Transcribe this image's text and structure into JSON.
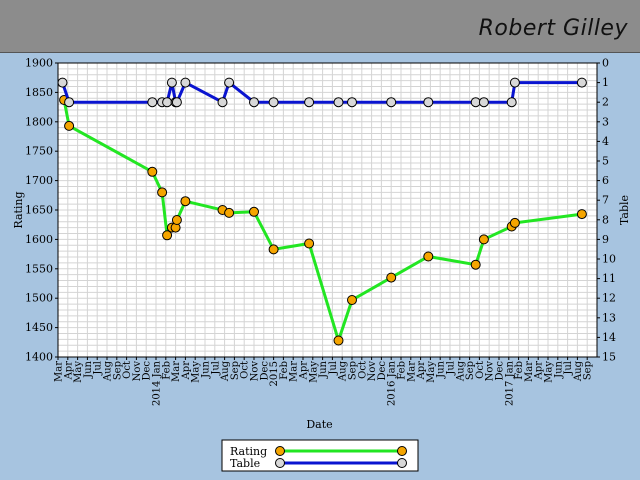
{
  "header": {
    "player_name": "Robert Gilley"
  },
  "colors": {
    "rating_line": "#22e622",
    "table_line": "#0a14d0",
    "rating_marker": "#f5a500",
    "table_marker": "#d8d8d8",
    "plot_bg": "#ffffff",
    "grid": "#d4d4d4",
    "frame_bg": "#a7c4e0",
    "banner_bg": "#8c8c8c"
  },
  "chart_data": {
    "type": "line",
    "xlabel": "Date",
    "ylabel": "Rating",
    "y2label": "Table",
    "ylim": [
      1400,
      1900
    ],
    "y2lim": [
      0,
      15
    ],
    "y2_inverted": true,
    "grid": true,
    "legend_position": "bottom-center",
    "x_tick_labels": [
      "Mar",
      "Apr",
      "May",
      "Jun",
      "Jul",
      "Aug",
      "Sep",
      "Oct",
      "Nov",
      "Dec",
      "2014 Jan",
      "Feb",
      "Mar",
      "Apr",
      "May",
      "Jun",
      "Jul",
      "Aug",
      "Sep",
      "Oct",
      "Nov",
      "Dec",
      "2015",
      "Feb",
      "Mar",
      "Apr",
      "May",
      "Jun",
      "Jul",
      "Aug",
      "Sep",
      "Oct",
      "Nov",
      "Dec",
      "2016 Jan",
      "Feb",
      "Mar",
      "Apr",
      "May",
      "Jun",
      "Jul",
      "Aug",
      "Sep",
      "Oct",
      "Nov",
      "Dec",
      "2017 Jan",
      "Feb",
      "Mar",
      "Apr",
      "May",
      "Jun",
      "Jul",
      "Aug",
      "Sep"
    ],
    "y_ticks": [
      1400,
      1450,
      1500,
      1550,
      1600,
      1650,
      1700,
      1750,
      1800,
      1850,
      1900
    ],
    "y2_ticks": [
      0,
      1,
      2,
      3,
      4,
      5,
      6,
      7,
      8,
      9,
      10,
      11,
      12,
      13,
      14,
      15
    ],
    "series": [
      {
        "name": "Rating",
        "axis": "left",
        "points": [
          [
            "2013-03-20",
            1837
          ],
          [
            "2013-04-05",
            1793
          ],
          [
            "2013-12-20",
            1715
          ],
          [
            "2014-01-20",
            1680
          ],
          [
            "2014-02-05",
            1607
          ],
          [
            "2014-02-20",
            1620
          ],
          [
            "2014-03-01",
            1620
          ],
          [
            "2014-03-05",
            1633
          ],
          [
            "2014-04-01",
            1665
          ],
          [
            "2014-07-25",
            1650
          ],
          [
            "2014-08-15",
            1645
          ],
          [
            "2014-11-01",
            1647
          ],
          [
            "2015-01-01",
            1583
          ],
          [
            "2015-04-20",
            1593
          ],
          [
            "2015-07-20",
            1428
          ],
          [
            "2015-09-01",
            1497
          ],
          [
            "2016-01-01",
            1535
          ],
          [
            "2016-04-25",
            1571
          ],
          [
            "2016-09-20",
            1557
          ],
          [
            "2016-10-15",
            1600
          ],
          [
            "2017-01-10",
            1622
          ],
          [
            "2017-01-20",
            1628
          ],
          [
            "2017-08-15",
            1643
          ]
        ]
      },
      {
        "name": "Table",
        "axis": "right",
        "points": [
          [
            "2013-03-15",
            1
          ],
          [
            "2013-04-05",
            2
          ],
          [
            "2013-12-20",
            2
          ],
          [
            "2014-01-20",
            2
          ],
          [
            "2014-02-05",
            2
          ],
          [
            "2014-02-20",
            1
          ],
          [
            "2014-03-01",
            2
          ],
          [
            "2014-03-05",
            2
          ],
          [
            "2014-04-01",
            1
          ],
          [
            "2014-07-25",
            2
          ],
          [
            "2014-08-15",
            1
          ],
          [
            "2014-11-01",
            2
          ],
          [
            "2015-01-01",
            2
          ],
          [
            "2015-04-20",
            2
          ],
          [
            "2015-07-20",
            2
          ],
          [
            "2015-09-01",
            2
          ],
          [
            "2016-01-01",
            2
          ],
          [
            "2016-04-25",
            2
          ],
          [
            "2016-09-20",
            2
          ],
          [
            "2016-10-15",
            2
          ],
          [
            "2017-01-10",
            2
          ],
          [
            "2017-01-20",
            1
          ],
          [
            "2017-08-15",
            1
          ]
        ]
      }
    ]
  }
}
